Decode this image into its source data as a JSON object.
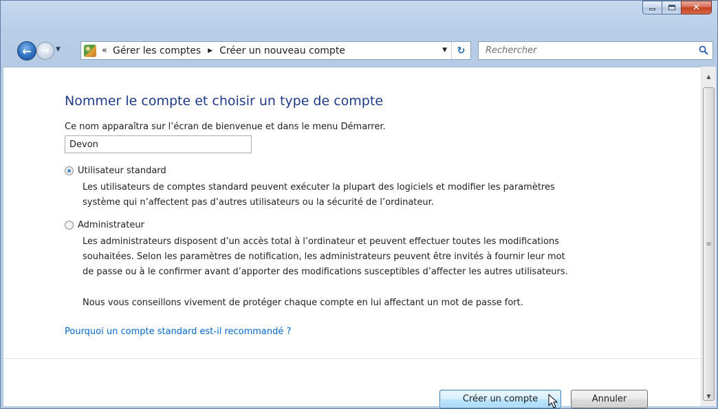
{
  "window": {
    "caption_buttons": {
      "minimize_icon": "minimize-icon",
      "maximize_icon": "maximize-icon",
      "close_glyph": "✕"
    }
  },
  "nav": {
    "back_glyph": "←",
    "forward_glyph": "→",
    "history_glyph": "▼",
    "address_overflow": "«",
    "breadcrumbs": [
      "Gérer les comptes",
      "Créer un nouveau compte"
    ],
    "crumb_separator": "▶",
    "address_dropdown_glyph": "▼",
    "refresh_glyph": "↻",
    "search_placeholder": "Rechercher"
  },
  "page": {
    "heading": "Nommer le compte et choisir un type de compte",
    "prompt": "Ce nom apparaîtra sur l’écran de bienvenue et dans le menu Démarrer.",
    "name_value": "Devon",
    "options": [
      {
        "label": "Utilisateur standard",
        "checked": true,
        "description": [
          "Les utilisateurs de comptes standard peuvent exécuter la plupart des logiciels et modifier les paramètres",
          "système qui n’affectent pas d’autres utilisateurs ou la sécurité de l’ordinateur."
        ]
      },
      {
        "label": "Administrateur",
        "checked": false,
        "description": [
          "Les administrateurs disposent d’un accès total à l’ordinateur et peuvent effectuer toutes les modifications",
          "souhaitées. Selon les paramètres de notification, les administrateurs peuvent être invités à fournir leur mot",
          "de passe ou à le confirmer avant d’apporter des modifications susceptibles d’affecter les autres utilisateurs."
        ]
      }
    ],
    "advice": "Nous vous conseillons vivement de protéger chaque compte en lui affectant un mot de passe fort.",
    "link": "Pourquoi un compte standard est-il recommandé ?",
    "buttons": {
      "create": "Créer un compte",
      "cancel": "Annuler"
    }
  },
  "scrollbar": {
    "up_glyph": "▲",
    "down_glyph": "▼",
    "grip_glyph": "≡"
  },
  "colors": {
    "heading": "#1e3a87",
    "link": "#0066cc",
    "frame": "#b9cfe8"
  }
}
